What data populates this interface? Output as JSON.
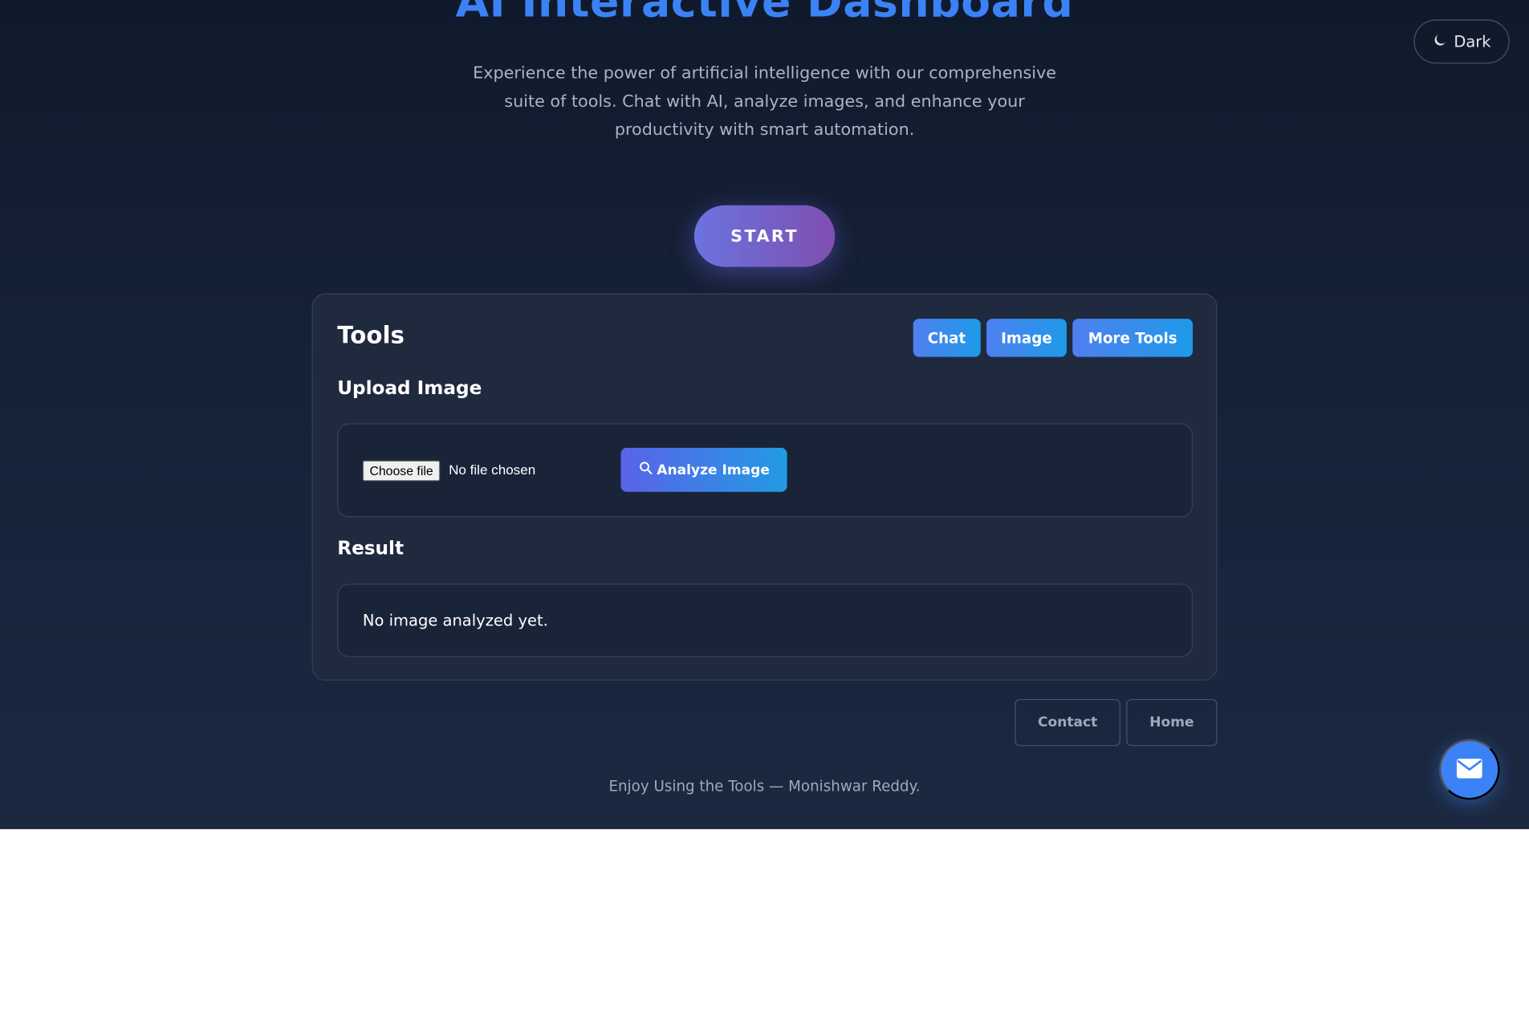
{
  "hero": {
    "title": "AI Interactive Dashboard",
    "description": "Experience the power of artificial intelligence with our comprehensive suite of tools. Chat with AI, analyze images, and enhance your productivity with smart automation."
  },
  "theme_toggle": {
    "icon": "moon-icon",
    "label": "Dark"
  },
  "start_button": {
    "label": "START"
  },
  "tools_card": {
    "title": "Tools",
    "tabs": [
      {
        "label": "Chat"
      },
      {
        "label": "Image"
      },
      {
        "label": "More Tools"
      }
    ],
    "upload": {
      "title": "Upload Image",
      "choose_file_label": "Choose file",
      "file_status": "No file chosen",
      "analyze_icon": "search-icon",
      "analyze_label": "Analyze Image"
    },
    "result": {
      "title": "Result",
      "text": "No image analyzed yet."
    }
  },
  "footer": {
    "links": [
      {
        "label": "Contact"
      },
      {
        "label": "Home"
      }
    ],
    "credit": "Enjoy Using the Tools — Monishwar Reddy."
  },
  "fab": {
    "icon": "envelope-icon"
  },
  "colors": {
    "accent_blue": "#3b82f6",
    "background_dark": "#162238",
    "card_background": "#1f2a3f",
    "start_gradient_start": "#6b73df",
    "start_gradient_end": "#7f4fb0"
  }
}
